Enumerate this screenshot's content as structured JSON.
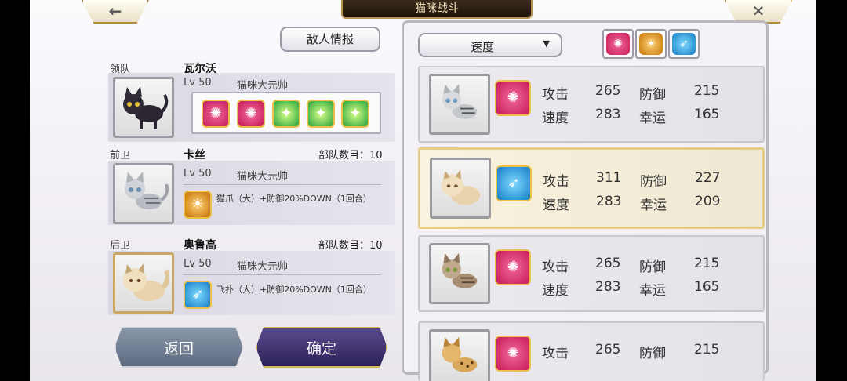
{
  "title": "猫咪战斗",
  "top": {
    "back_icon": "←",
    "close_icon": "✕"
  },
  "left": {
    "enemy_info_label": "敌人情报",
    "leader": {
      "role": "领队",
      "name": "瓦尔沃",
      "level": "Lv 50",
      "rank": "猫咪大元帅",
      "skills": [
        "red-claw",
        "red-claw",
        "green-sparkle",
        "green-sparkle",
        "green-sparkle"
      ]
    },
    "vanguard": {
      "role": "前卫",
      "name": "卡丝",
      "troops": "部队数目：10",
      "level": "Lv 50",
      "rank": "猫咪大元帅",
      "skill_text": "猫爪（大）+防御20%DOWN（1回合）"
    },
    "rearguard": {
      "role": "后卫",
      "name": "奥鲁高",
      "troops": "部队数目：10",
      "level": "Lv 50",
      "rank": "猫咪大元帅",
      "skill_text": "飞扑（大）+防御20%DOWN（1回合）"
    },
    "return_label": "返回",
    "confirm_label": "确定"
  },
  "right": {
    "sort_label": "速度",
    "filters": [
      "red-claw-icon",
      "orange-paw-icon",
      "blue-pounce-icon"
    ],
    "cards": [
      {
        "atk_label": "攻击",
        "atk": "265",
        "def_label": "防御",
        "def": "215",
        "spd_label": "速度",
        "spd": "283",
        "luck_label": "幸运",
        "luck": "165",
        "skill": "red",
        "cat": "silver-tabby",
        "selected": false
      },
      {
        "atk_label": "攻击",
        "atk": "311",
        "def_label": "防御",
        "def": "227",
        "spd_label": "速度",
        "spd": "283",
        "luck_label": "幸运",
        "luck": "209",
        "skill": "blue",
        "cat": "persian",
        "selected": true
      },
      {
        "atk_label": "攻击",
        "atk": "265",
        "def_label": "防御",
        "def": "215",
        "spd_label": "速度",
        "spd": "283",
        "luck_label": "幸运",
        "luck": "165",
        "skill": "red",
        "cat": "brown-tabby",
        "selected": false
      },
      {
        "atk_label": "攻击",
        "atk": "265",
        "def_label": "防御",
        "def": "215",
        "spd_label": "速度",
        "spd": "",
        "luck_label": "",
        "luck": "",
        "skill": "red",
        "cat": "leopard",
        "selected": false
      }
    ]
  },
  "colors": {
    "accent_gold": "#d6b35d",
    "skill_red": "#c81a59",
    "skill_blue": "#157fc7",
    "skill_green": "#2aa13a"
  }
}
